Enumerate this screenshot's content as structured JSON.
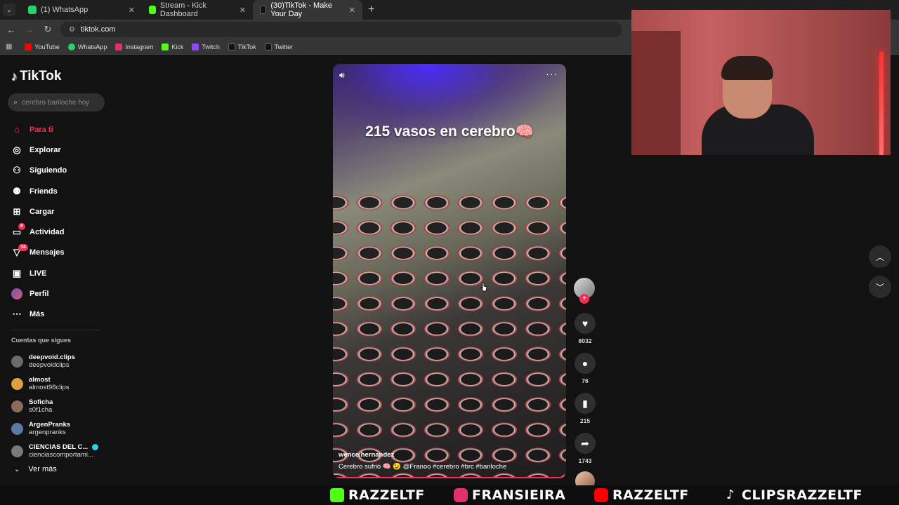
{
  "browser": {
    "tabs": [
      {
        "title": "(1) WhatsApp",
        "icon": "whatsapp-icon",
        "color": "#25D366"
      },
      {
        "title": "Stream - Kick Dashboard",
        "icon": "kick-icon",
        "color": "#53FC18"
      },
      {
        "title": "(30)TikTok - Make Your Day",
        "icon": "tiktok-icon",
        "color": "#000000",
        "active": true
      }
    ],
    "url": "tiktok.com",
    "bookmarks": [
      {
        "label": "YouTube",
        "color": "#FF0000"
      },
      {
        "label": "WhatsApp",
        "color": "#25D366"
      },
      {
        "label": "Instagram",
        "color": "#E1306C"
      },
      {
        "label": "Kick",
        "color": "#53FC18"
      },
      {
        "label": "Twitch",
        "color": "#9146FF"
      },
      {
        "label": "TikTok",
        "color": "#000000"
      },
      {
        "label": "Twitter",
        "color": "#000000"
      }
    ]
  },
  "tiktok": {
    "logo": "TikTok",
    "search_placeholder": "cerebro bariloche hoy",
    "menu": [
      {
        "label": "Para ti",
        "icon": "home-icon",
        "active": true
      },
      {
        "label": "Explorar",
        "icon": "compass-icon"
      },
      {
        "label": "Siguiendo",
        "icon": "following-icon"
      },
      {
        "label": "Friends",
        "icon": "friends-icon"
      },
      {
        "label": "Cargar",
        "icon": "upload-icon"
      },
      {
        "label": "Actividad",
        "icon": "activity-icon",
        "badge": "6"
      },
      {
        "label": "Mensajes",
        "icon": "messages-icon",
        "badge": "34"
      },
      {
        "label": "LIVE",
        "icon": "live-icon"
      },
      {
        "label": "Perfil",
        "icon": "profile-avatar"
      },
      {
        "label": "Más",
        "icon": "more-icon"
      }
    ],
    "following_title": "Cuentas que sigues",
    "following": [
      {
        "name": "deepvoid.clips",
        "handle": "deepvoidclips",
        "color": "#6a6a6a"
      },
      {
        "name": "almost",
        "handle": "almost98clips",
        "color": "#e0a040"
      },
      {
        "name": "Soficha",
        "handle": "s0f1cha",
        "color": "#8a6a5a"
      },
      {
        "name": "ArgenPranks",
        "handle": "argenpranks",
        "color": "#5a7aa0"
      },
      {
        "name": "CIENCIAS DEL C...",
        "handle": "cienciascomportami...",
        "color": "#7a7a7a",
        "verified": true
      }
    ],
    "see_more": "Ver más"
  },
  "video": {
    "overlay_text": "215 vasos en cerebro🧠",
    "username": "wence.hernandez",
    "description": "Cerebro sufrió 🧠 😉 @Franoo  #cerebro  #brc  #bariloche",
    "likes": "8032",
    "comments": "76",
    "saves": "215",
    "shares": "1743"
  },
  "stream_footer": [
    {
      "label": "RAZZELTF",
      "platform": "kick",
      "color": "#53FC18"
    },
    {
      "label": "FRANSIEIRA",
      "platform": "instagram",
      "color": "#E1306C"
    },
    {
      "label": "RAZZELTF",
      "platform": "youtube",
      "color": "#FF0000"
    },
    {
      "label": "CLIPSRAZZELTF",
      "platform": "tiktok",
      "color": "#FFFFFF"
    }
  ]
}
